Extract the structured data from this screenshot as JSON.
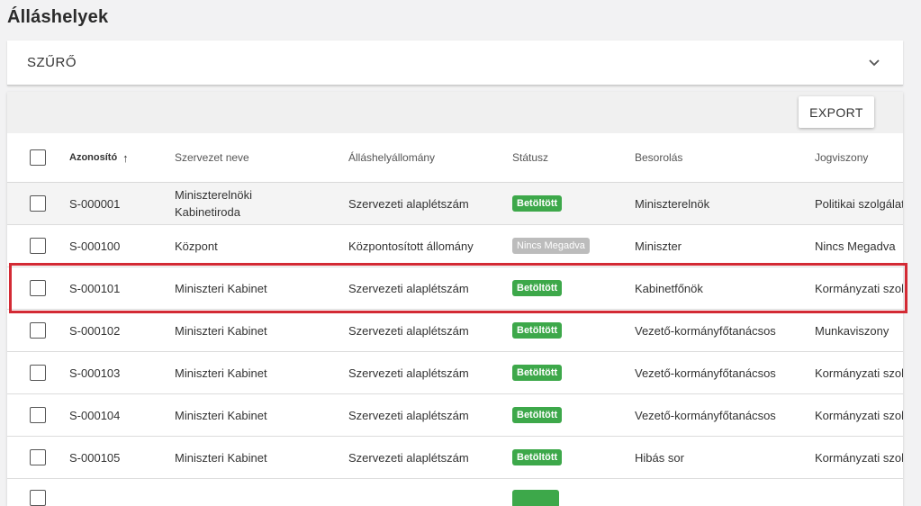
{
  "page": {
    "title": "Álláshelyek"
  },
  "filter": {
    "label": "SZŰRŐ",
    "icon": "chevron-down-icon"
  },
  "toolbar": {
    "export_label": "EXPORT"
  },
  "colors": {
    "accent_green": "#3da84a",
    "badge_grey": "#bcbcbc",
    "highlight_red": "#d32a34"
  },
  "table": {
    "headers": {
      "id": "Azonosító",
      "org": "Szervezet neve",
      "position": "Álláshelyállomány",
      "status": "Státusz",
      "classification": "Besorolás",
      "legal": "Jogviszony"
    },
    "sort": {
      "column": "Azonosító",
      "direction": "ascending",
      "icon": "arrow-up-icon"
    },
    "rows": [
      {
        "id": "S-000001",
        "org": "Miniszterelnöki Kabinetiroda",
        "position": "Szervezeti alaplétszám",
        "status": "Betöltött",
        "classification": "Miniszterelnök",
        "legal": "Politikai szolgálat"
      },
      {
        "id": "S-000100",
        "org": "Központ",
        "position": "Központosított állomány",
        "status": "Nincs Megadva",
        "classification": "Miniszter",
        "legal": "Nincs Megadva"
      },
      {
        "id": "S-000101",
        "org": "Miniszteri Kabinet",
        "position": "Szervezeti alaplétszám",
        "status": "Betöltött",
        "classification": "Kabinetfőnök",
        "legal": "Kormányzati szolg"
      },
      {
        "id": "S-000102",
        "org": "Miniszteri Kabinet",
        "position": "Szervezeti alaplétszám",
        "status": "Betöltött",
        "classification": "Vezető-kormányfőtanácsos",
        "legal": "Munkaviszony"
      },
      {
        "id": "S-000103",
        "org": "Miniszteri Kabinet",
        "position": "Szervezeti alaplétszám",
        "status": "Betöltött",
        "classification": "Vezető-kormányfőtanácsos",
        "legal": "Kormányzati szolg"
      },
      {
        "id": "S-000104",
        "org": "Miniszteri Kabinet",
        "position": "Szervezeti alaplétszám",
        "status": "Betöltött",
        "classification": "Vezető-kormányfőtanácsos",
        "legal": "Kormányzati szolg"
      },
      {
        "id": "S-000105",
        "org": "Miniszteri Kabinet",
        "position": "Szervezeti alaplétszám",
        "status": "Betöltött",
        "classification": "Hibás sor",
        "legal": "Kormányzati szolg"
      }
    ]
  }
}
